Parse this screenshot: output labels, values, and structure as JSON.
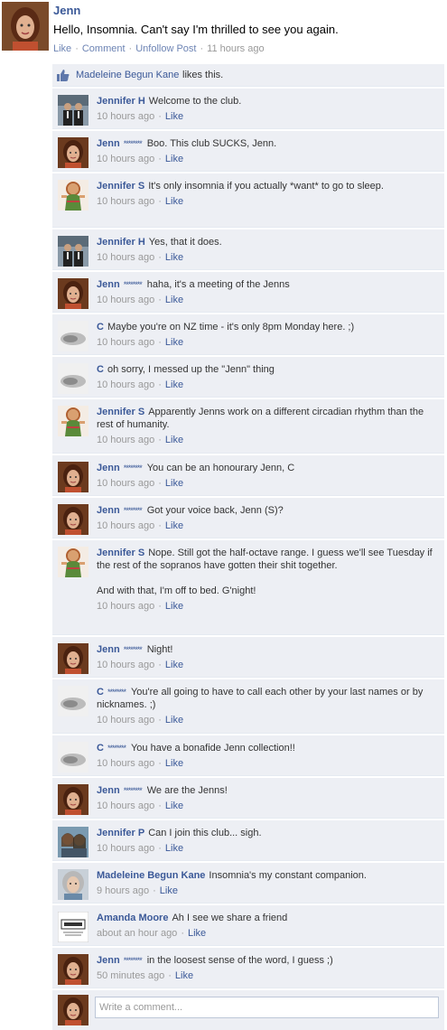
{
  "post": {
    "author": "Jenn",
    "text": "Hello, Insomnia. Can't say I'm thrilled to see you again.",
    "actions": {
      "like": "Like",
      "comment": "Comment",
      "unfollow": "Unfollow Post",
      "time": "11 hours ago"
    },
    "avatar_icon": "jenn-avatar-icon"
  },
  "likes": {
    "liker": "Madeleine Begun Kane",
    "text": "likes this.",
    "icon": "thumbs-up-icon"
  },
  "comment_like_label": "Like",
  "comments": [
    {
      "author": "Jennifer H",
      "masked": false,
      "text": "Welcome to the club.",
      "time": "10 hours ago",
      "avatar": "couple-photo-avatar"
    },
    {
      "author": "Jenn",
      "masked": true,
      "text": "Boo. This club SUCKS, Jenn.",
      "time": "10 hours ago",
      "avatar": "jenn-avatar"
    },
    {
      "author": "Jennifer S",
      "masked": false,
      "text": "It's only insomnia if you actually *want* to go to sleep.",
      "time": "10 hours ago",
      "avatar": "doll-avatar"
    },
    {
      "author": "Jennifer H",
      "masked": false,
      "text": "Yes, that it does.",
      "time": "10 hours ago",
      "avatar": "couple-photo-avatar"
    },
    {
      "author": "Jenn",
      "masked": true,
      "text": "haha, it's a meeting of the Jenns",
      "time": "10 hours ago",
      "avatar": "jenn-avatar"
    },
    {
      "author": "C",
      "masked": false,
      "text": "Maybe you're on NZ time - it's only 8pm Monday here. ;)",
      "time": "10 hours ago",
      "avatar": "blurred-avatar"
    },
    {
      "author": "C",
      "masked": false,
      "text": "oh sorry, I messed up the \"Jenn\" thing",
      "time": "10 hours ago",
      "avatar": "blurred-avatar"
    },
    {
      "author": "Jennifer S",
      "masked": false,
      "text": "Apparently Jenns work on a different circadian rhythm than the rest of humanity.",
      "time": "10 hours ago",
      "avatar": "doll-avatar"
    },
    {
      "author": "Jenn",
      "masked": true,
      "text": "You can be an honourary Jenn, C",
      "time": "10 hours ago",
      "avatar": "jenn-avatar"
    },
    {
      "author": "Jenn",
      "masked": true,
      "text": "Got your voice back, Jenn (S)?",
      "time": "10 hours ago",
      "avatar": "jenn-avatar"
    },
    {
      "author": "Jennifer S",
      "masked": false,
      "text": "Nope. Still got the half-octave range. I guess we'll see Tuesday if the rest of the sopranos have gotten their shit together.",
      "text2": "And with that, I'm off to bed. G'night!",
      "time": "10 hours ago",
      "avatar": "doll-avatar"
    },
    {
      "author": "Jenn",
      "masked": true,
      "text": "Night!",
      "time": "10 hours ago",
      "avatar": "jenn-avatar"
    },
    {
      "author": "C",
      "masked": true,
      "text": "You're all going to have to call each other by your last names or by nicknames. ;)",
      "time": "10 hours ago",
      "avatar": "blurred-avatar"
    },
    {
      "author": "C",
      "masked": true,
      "text": "You have a bonafide Jenn collection!!",
      "time": "10 hours ago",
      "avatar": "blurred-avatar"
    },
    {
      "author": "Jenn",
      "masked": true,
      "text": "We are the Jenns!",
      "time": "10 hours ago",
      "avatar": "jenn-avatar"
    },
    {
      "author": "Jennifer P",
      "masked": false,
      "text": "Can I join this club... sigh.",
      "time": "10 hours ago",
      "avatar": "two-women-avatar"
    },
    {
      "author": "Madeleine Begun Kane",
      "masked": false,
      "text": "Insomnia's my constant companion.",
      "time": "9 hours ago",
      "avatar": "grey-hair-avatar"
    },
    {
      "author": "Amanda Moore",
      "masked": false,
      "text": "Ah I see we share a friend",
      "time": "about an hour ago",
      "avatar": "respect-sign-avatar"
    },
    {
      "author": "Jenn",
      "masked": true,
      "text": "in the loosest sense of the word, I guess ;)",
      "time": "50 minutes ago",
      "avatar": "jenn-avatar"
    }
  ],
  "mask_glyph": "********",
  "composer": {
    "placeholder": "Write a comment...",
    "avatar_icon": "jenn-avatar-icon"
  },
  "colors": {
    "link": "#3b5998",
    "feedback_bg": "#edeff4",
    "meta": "#999999"
  }
}
